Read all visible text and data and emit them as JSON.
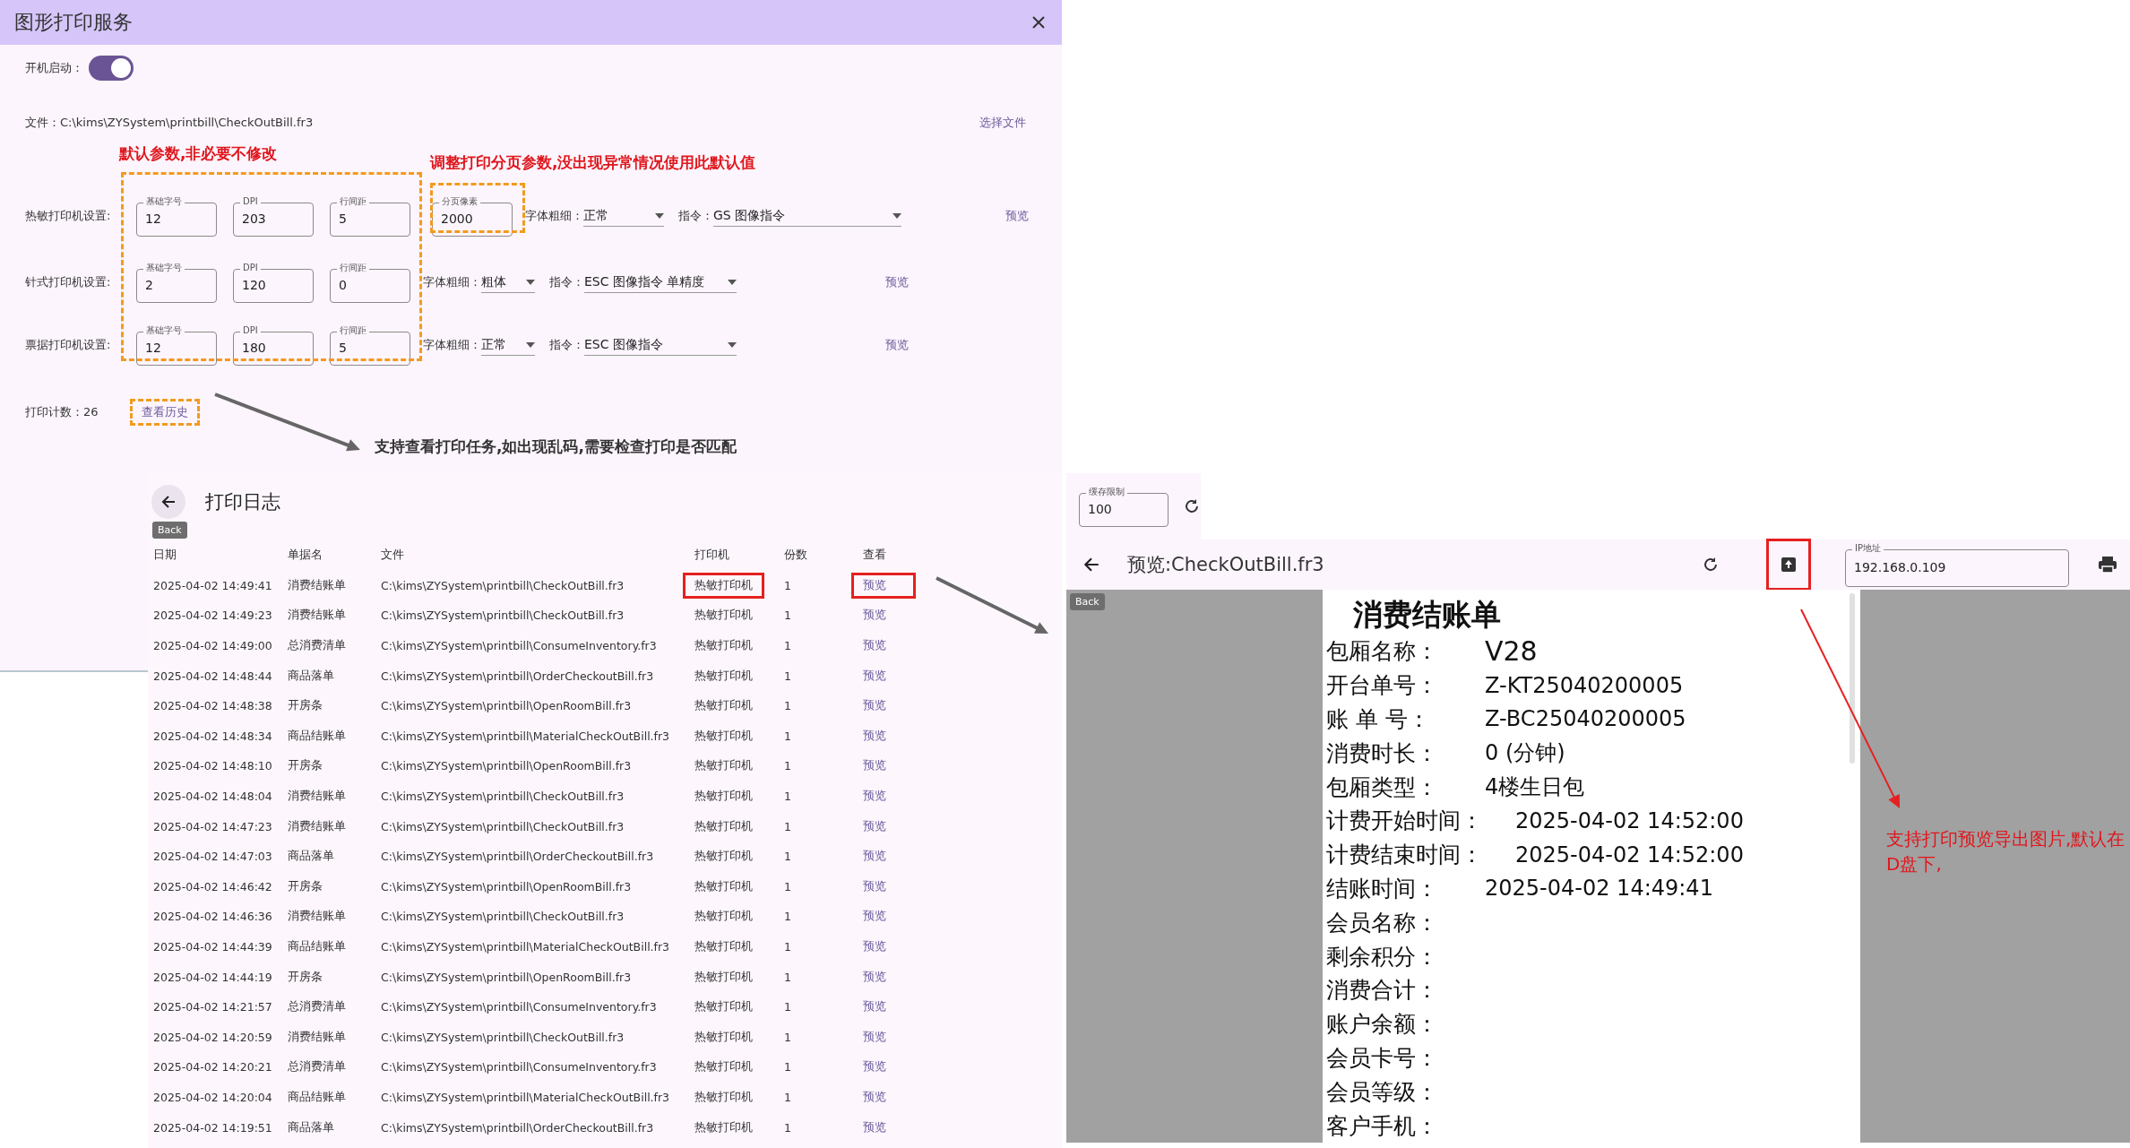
{
  "settings_window": {
    "title": "图形打印服务",
    "autostart": {
      "label": "开机启动：",
      "on": true
    },
    "file": {
      "text": "文件：C:\\kims\\ZYSystem\\printbill\\CheckOutBill.fr3",
      "link": "选择文件"
    },
    "printers": [
      {
        "label": "热敏打印机设置:",
        "fields": [
          {
            "label": "基础字号",
            "value": "12"
          },
          {
            "label": "DPI",
            "value": "203"
          },
          {
            "label": "行间距",
            "value": "5"
          }
        ],
        "page_field": {
          "label": "分页像素",
          "value": "2000"
        },
        "weight": {
          "label": "字体粗细：",
          "value": "正常"
        },
        "command": {
          "label": "指令：",
          "value": "GS 图像指令"
        },
        "preview": "预览"
      },
      {
        "label": "针式打印机设置:",
        "fields": [
          {
            "label": "基础字号",
            "value": "2"
          },
          {
            "label": "DPI",
            "value": "120"
          },
          {
            "label": "行间距",
            "value": "0"
          }
        ],
        "weight": {
          "label": "字体粗细：",
          "value": "粗体"
        },
        "command": {
          "label": "指令：",
          "value": "ESC 图像指令 单精度"
        },
        "preview": "预览"
      },
      {
        "label": "票据打印机设置:",
        "fields": [
          {
            "label": "基础字号",
            "value": "12"
          },
          {
            "label": "DPI",
            "value": "180"
          },
          {
            "label": "行间距",
            "value": "5"
          }
        ],
        "weight": {
          "label": "字体粗细：",
          "value": "正常"
        },
        "command": {
          "label": "指令：",
          "value": "ESC 图像指令"
        },
        "preview": "预览"
      }
    ],
    "print_count": "打印计数：26",
    "history_link": "查看历史"
  },
  "annotations": [
    {
      "kind": "red",
      "text": "默认参数,非必要不修改"
    },
    {
      "kind": "red",
      "text": "调整打印分页参数,没出现异常情况使用此默认值"
    },
    {
      "kind": "dark",
      "text": "支持查看打印任务,如出现乱码,需要检查打印是否匹配"
    },
    {
      "kind": "note",
      "text": "支持打印预览导出图片,默认在D盘下,"
    }
  ],
  "print_log": {
    "title": "打印日志",
    "tooltip": "Back",
    "columns": [
      "日期",
      "单据名",
      "文件",
      "打印机",
      "份数",
      "查看"
    ],
    "rows": [
      [
        "2025-04-02 14:49:41",
        "消费结账单",
        "C:\\kims\\ZYSystem\\printbill\\CheckOutBill.fr3",
        "热敏打印机",
        "1",
        "预览"
      ],
      [
        "2025-04-02 14:49:23",
        "消费结账单",
        "C:\\kims\\ZYSystem\\printbill\\CheckOutBill.fr3",
        "热敏打印机",
        "1",
        "预览"
      ],
      [
        "2025-04-02 14:49:00",
        "总消费清单",
        "C:\\kims\\ZYSystem\\printbill\\ConsumeInventory.fr3",
        "热敏打印机",
        "1",
        "预览"
      ],
      [
        "2025-04-02 14:48:44",
        "商品落单",
        "C:\\kims\\ZYSystem\\printbill\\OrderCheckoutBill.fr3",
        "热敏打印机",
        "1",
        "预览"
      ],
      [
        "2025-04-02 14:48:38",
        "开房条",
        "C:\\kims\\ZYSystem\\printbill\\OpenRoomBill.fr3",
        "热敏打印机",
        "1",
        "预览"
      ],
      [
        "2025-04-02 14:48:34",
        "商品结账单",
        "C:\\kims\\ZYSystem\\printbill\\MaterialCheckOutBill.fr3",
        "热敏打印机",
        "1",
        "预览"
      ],
      [
        "2025-04-02 14:48:10",
        "开房条",
        "C:\\kims\\ZYSystem\\printbill\\OpenRoomBill.fr3",
        "热敏打印机",
        "1",
        "预览"
      ],
      [
        "2025-04-02 14:48:04",
        "消费结账单",
        "C:\\kims\\ZYSystem\\printbill\\CheckOutBill.fr3",
        "热敏打印机",
        "1",
        "预览"
      ],
      [
        "2025-04-02 14:47:23",
        "消费结账单",
        "C:\\kims\\ZYSystem\\printbill\\CheckOutBill.fr3",
        "热敏打印机",
        "1",
        "预览"
      ],
      [
        "2025-04-02 14:47:03",
        "商品落单",
        "C:\\kims\\ZYSystem\\printbill\\OrderCheckoutBill.fr3",
        "热敏打印机",
        "1",
        "预览"
      ],
      [
        "2025-04-02 14:46:42",
        "开房条",
        "C:\\kims\\ZYSystem\\printbill\\OpenRoomBill.fr3",
        "热敏打印机",
        "1",
        "预览"
      ],
      [
        "2025-04-02 14:46:36",
        "消费结账单",
        "C:\\kims\\ZYSystem\\printbill\\CheckOutBill.fr3",
        "热敏打印机",
        "1",
        "预览"
      ],
      [
        "2025-04-02 14:44:39",
        "商品结账单",
        "C:\\kims\\ZYSystem\\printbill\\MaterialCheckOutBill.fr3",
        "热敏打印机",
        "1",
        "预览"
      ],
      [
        "2025-04-02 14:44:19",
        "开房条",
        "C:\\kims\\ZYSystem\\printbill\\OpenRoomBill.fr3",
        "热敏打印机",
        "1",
        "预览"
      ],
      [
        "2025-04-02 14:21:57",
        "总消费清单",
        "C:\\kims\\ZYSystem\\printbill\\ConsumeInventory.fr3",
        "热敏打印机",
        "1",
        "预览"
      ],
      [
        "2025-04-02 14:20:59",
        "消费结账单",
        "C:\\kims\\ZYSystem\\printbill\\CheckOutBill.fr3",
        "热敏打印机",
        "1",
        "预览"
      ],
      [
        "2025-04-02 14:20:21",
        "总消费清单",
        "C:\\kims\\ZYSystem\\printbill\\ConsumeInventory.fr3",
        "热敏打印机",
        "1",
        "预览"
      ],
      [
        "2025-04-02 14:20:04",
        "商品结账单",
        "C:\\kims\\ZYSystem\\printbill\\MaterialCheckOutBill.fr3",
        "热敏打印机",
        "1",
        "预览"
      ],
      [
        "2025-04-02 14:19:51",
        "商品落单",
        "C:\\kims\\ZYSystem\\printbill\\OrderCheckoutBill.fr3",
        "热敏打印机",
        "1",
        "预览"
      ]
    ]
  },
  "cache_limit": {
    "label": "缓存限制",
    "value": "100"
  },
  "preview_window": {
    "title": "预览:CheckOutBill.fr3",
    "tooltip": "Back",
    "ip": {
      "label": "IP地址",
      "value": "192.168.0.109"
    },
    "receipt": {
      "heading": "消费结账单",
      "lines": [
        {
          "label": "包厢名称：",
          "value": "V28",
          "big": true
        },
        {
          "label": "开台单号：",
          "value": "Z-KT25040200005"
        },
        {
          "label": "账 单 号：",
          "value": "Z-BC25040200005"
        },
        {
          "label": "消费时长：",
          "value": "0 (分钟)"
        },
        {
          "label": "包厢类型：",
          "value": "4楼生日包"
        },
        {
          "label": "计费开始时间：",
          "value": "2025-04-02 14:52:00"
        },
        {
          "label": "计费结束时间：",
          "value": "2025-04-02 14:52:00"
        },
        {
          "label": "结账时间：",
          "value": "2025-04-02 14:49:41"
        },
        {
          "label": "会员名称："
        },
        {
          "label": "剩余积分："
        },
        {
          "label": "消费合计："
        },
        {
          "label": "账户余额："
        },
        {
          "label": "会员卡号："
        },
        {
          "label": "会员等级："
        },
        {
          "label": "客户手机："
        }
      ]
    }
  }
}
